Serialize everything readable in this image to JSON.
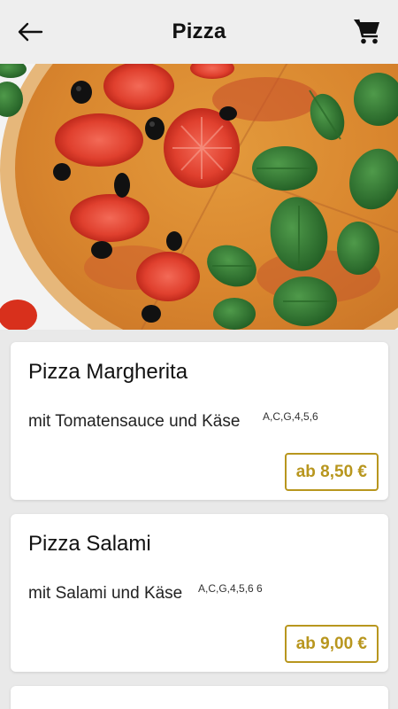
{
  "header": {
    "title": "Pizza",
    "back_icon": "arrow-left-icon",
    "cart_icon": "shopping-cart-icon"
  },
  "hero": {
    "image": "pizza-photo"
  },
  "products": [
    {
      "name": "Pizza Margherita",
      "description": "mit Tomatensauce und Käse",
      "allergens": "A,C,G,4,5,6",
      "price": "ab 8,50 €"
    },
    {
      "name": "Pizza Salami",
      "description": "mit Salami und Käse",
      "allergens": "A,C,G,4,5,6 6",
      "price": "ab 9,00 €"
    }
  ],
  "colors": {
    "accent": "#b8961e",
    "header_bg": "#eeeeee",
    "page_bg": "#e9e9e9"
  }
}
